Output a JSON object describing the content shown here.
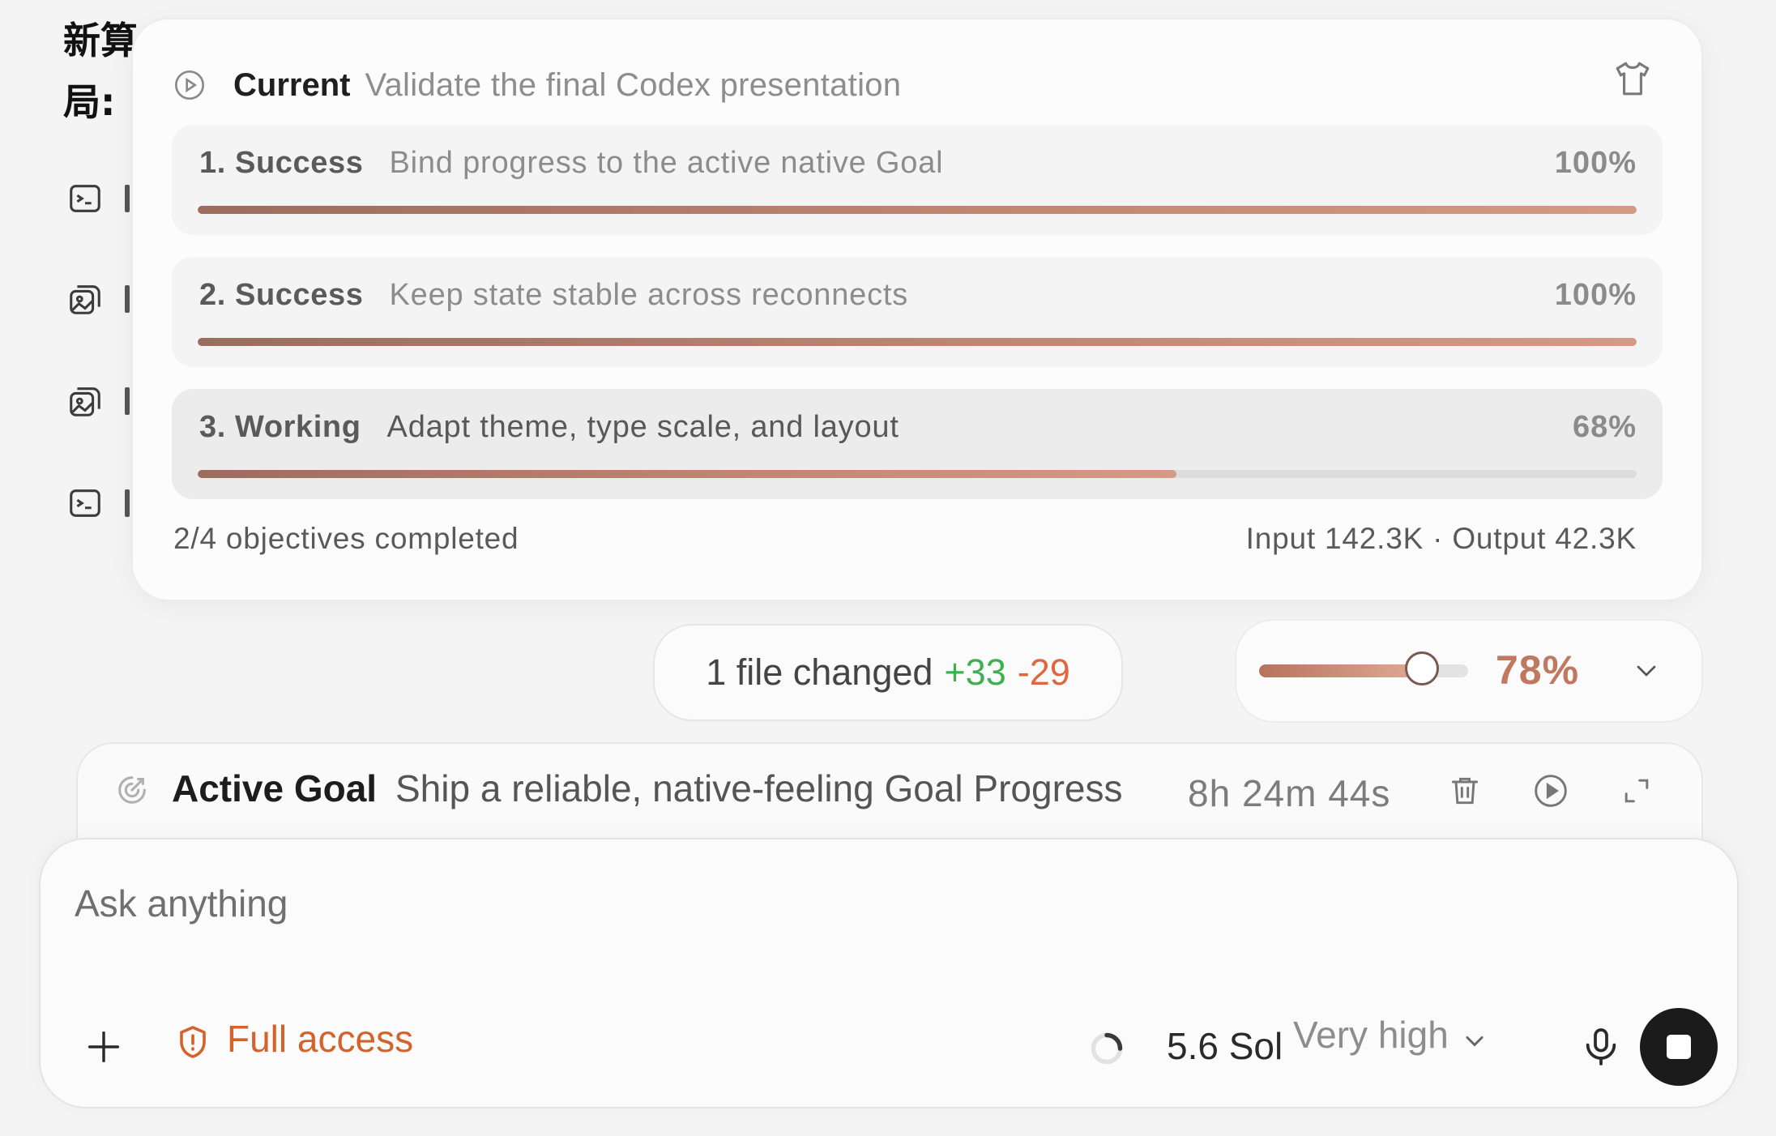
{
  "transcript": {
    "line1": "新算",
    "line2": "局:",
    "icons": [
      "terminal-icon",
      "images-icon",
      "images-icon",
      "terminal-icon"
    ]
  },
  "current": {
    "title": "Current",
    "description": "Validate the final Codex presentation",
    "icons": {
      "status": "play-circle-icon",
      "theme": "shirt-icon"
    }
  },
  "objectives": [
    {
      "label": "1. Success",
      "text": "Bind progress to the active native Goal",
      "percent_label": "100%",
      "progress": 100,
      "state": "success"
    },
    {
      "label": "2. Success",
      "text": "Keep state stable across reconnects",
      "percent_label": "100%",
      "progress": 100,
      "state": "success"
    },
    {
      "label": "3. Working",
      "text": "Adapt theme, type scale, and layout",
      "percent_label": "68%",
      "progress": 68,
      "state": "working"
    }
  ],
  "summary": {
    "completed": "2/4 objectives completed",
    "tokens": "Input 142.3K · Output 42.3K"
  },
  "changes": {
    "label": "1 file changed",
    "added": "+33",
    "removed": "-29"
  },
  "budget": {
    "percent_label": "78%",
    "value": 78
  },
  "goal": {
    "title": "Active Goal",
    "description": "Ship a reliable, native-feeling Goal Progress",
    "elapsed": "8h 24m 44s",
    "icons": [
      "goal-icon",
      "trash-icon",
      "play-circle-icon",
      "expand-icon"
    ]
  },
  "composer": {
    "placeholder": "Ask anything",
    "access": "Full access",
    "model": "5.6 Sol",
    "effort": "Very high"
  },
  "colors": {
    "accent": "#c0785f",
    "access": "#d4622b",
    "added": "#3fb04f",
    "removed": "#e0663e"
  }
}
